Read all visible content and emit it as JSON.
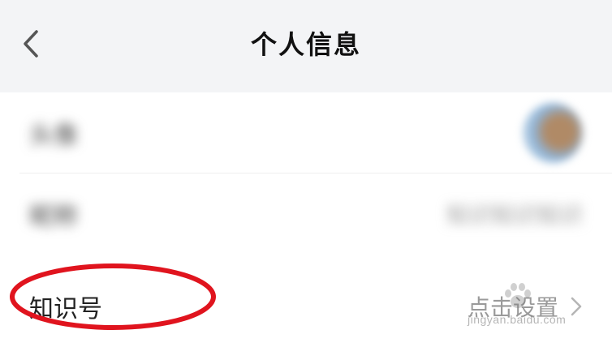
{
  "header": {
    "title": "个人信息",
    "back_icon": "chevron-left-icon"
  },
  "rows": [
    {
      "label": "头像",
      "value": "",
      "has_avatar": true
    },
    {
      "label": "昵称",
      "value": "知识知识知识",
      "has_avatar": false
    },
    {
      "label": "知识号",
      "value": "点击设置",
      "chevron_icon": "chevron-right-icon"
    }
  ],
  "annotation": {
    "color": "#e0141e",
    "target": "知识号"
  },
  "watermark": {
    "text": "jingyan.baidu.com"
  },
  "colors": {
    "navbar_bg": "#f3f4f6",
    "annotation_red": "#e0141e",
    "secondary_text": "#9a9a9a"
  }
}
